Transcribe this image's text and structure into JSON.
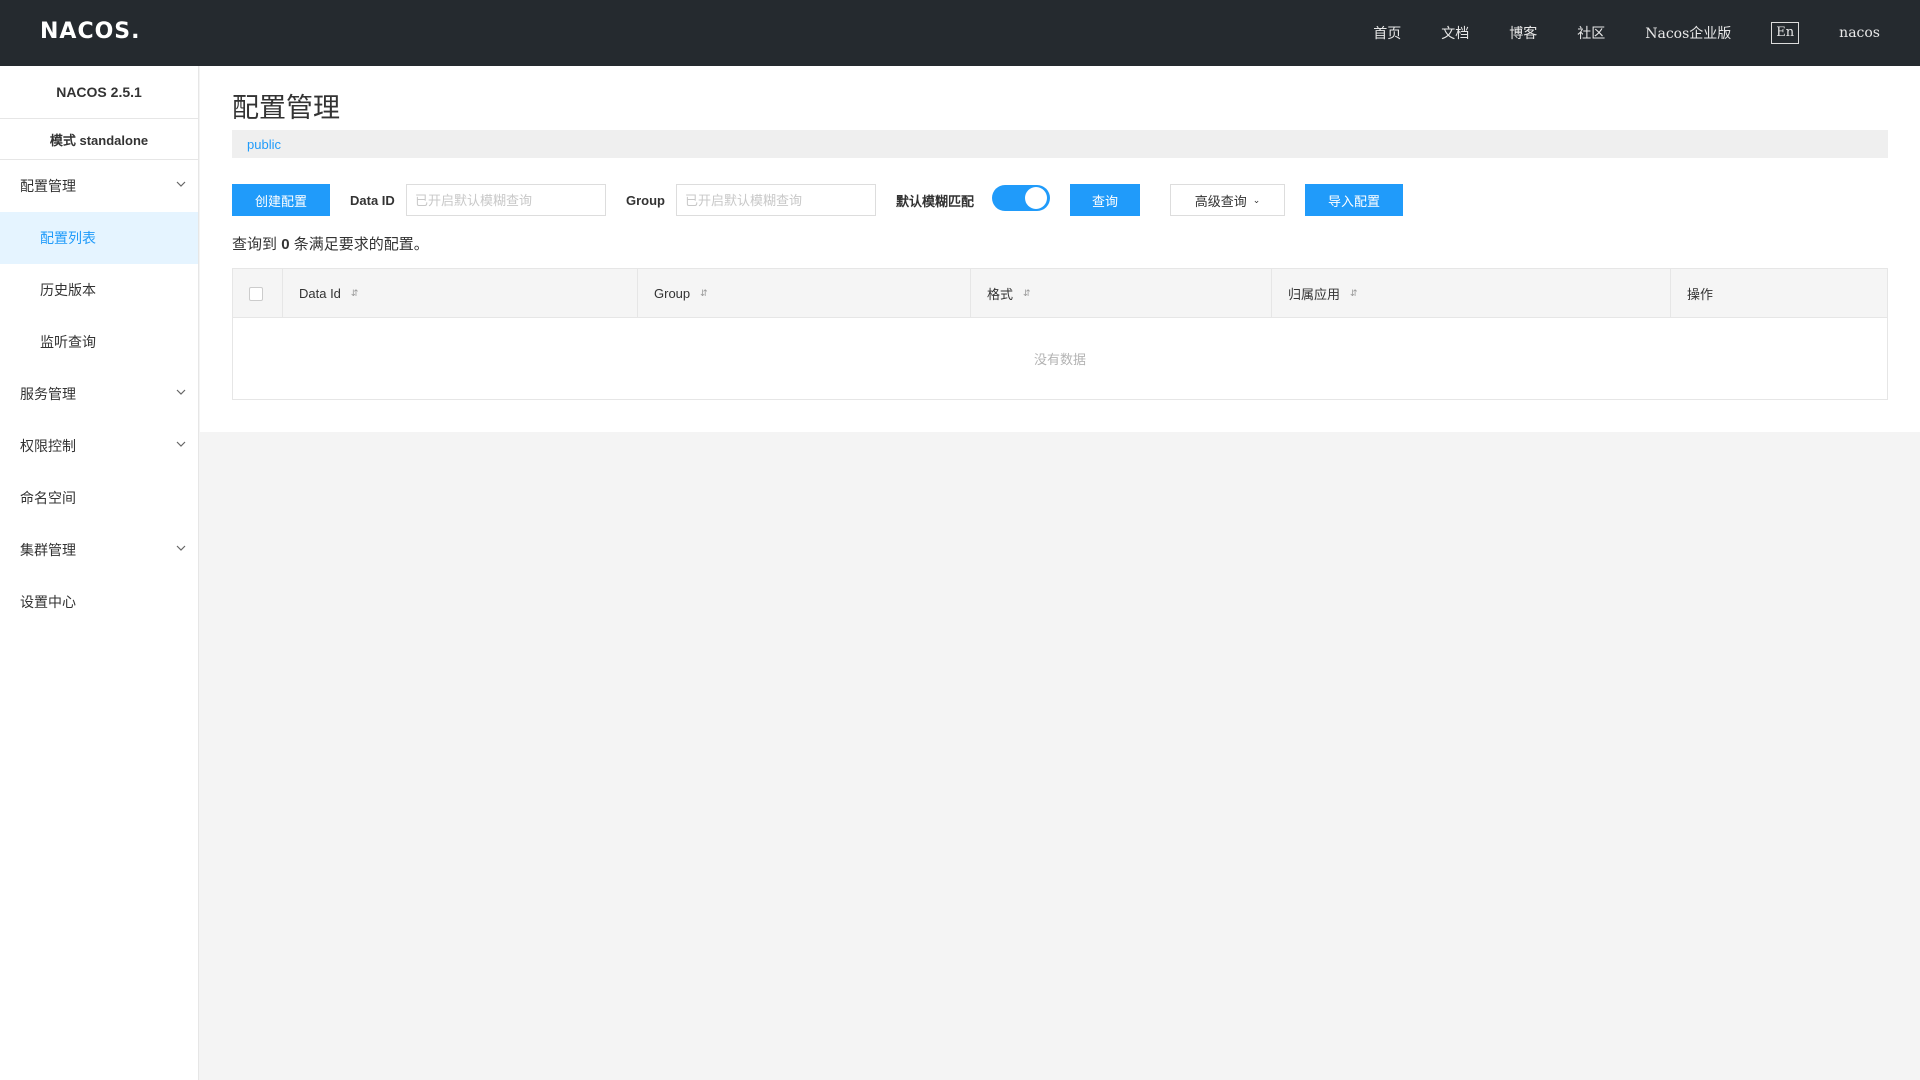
{
  "header": {
    "logo": "NACOS.",
    "nav": [
      "首页",
      "文档",
      "博客",
      "社区",
      "Nacos企业版"
    ],
    "lang_button": "En",
    "user": "nacos"
  },
  "sidebar": {
    "version": "NACOS 2.5.1",
    "mode": "模式 standalone",
    "items": [
      {
        "label": "配置管理",
        "expandable": true
      },
      {
        "label": "配置列表",
        "sub": true,
        "active": true
      },
      {
        "label": "历史版本",
        "sub": true
      },
      {
        "label": "监听查询",
        "sub": true
      },
      {
        "label": "服务管理",
        "expandable": true
      },
      {
        "label": "权限控制",
        "expandable": true
      },
      {
        "label": "命名空间"
      },
      {
        "label": "集群管理",
        "expandable": true
      },
      {
        "label": "设置中心"
      }
    ]
  },
  "main": {
    "title": "配置管理",
    "namespace": "public",
    "toolbar": {
      "create_button": "创建配置",
      "data_id_label": "Data ID",
      "data_id_placeholder": "已开启默认模糊查询",
      "group_label": "Group",
      "group_placeholder": "已开启默认模糊查询",
      "fuzzy_label": "默认模糊匹配",
      "fuzzy_on": true,
      "query_button": "查询",
      "advanced_button": "高级查询",
      "import_button": "导入配置"
    },
    "result": {
      "prefix": "查询到",
      "count": "0",
      "suffix": "条满足要求的配置。"
    },
    "table": {
      "columns": [
        "Data Id",
        "Group",
        "格式",
        "归属应用",
        "操作"
      ],
      "empty_text": "没有数据"
    }
  },
  "colors": {
    "accent": "#209bfa",
    "topbar": "#252a2f",
    "active_bg": "#e5f4ff"
  }
}
